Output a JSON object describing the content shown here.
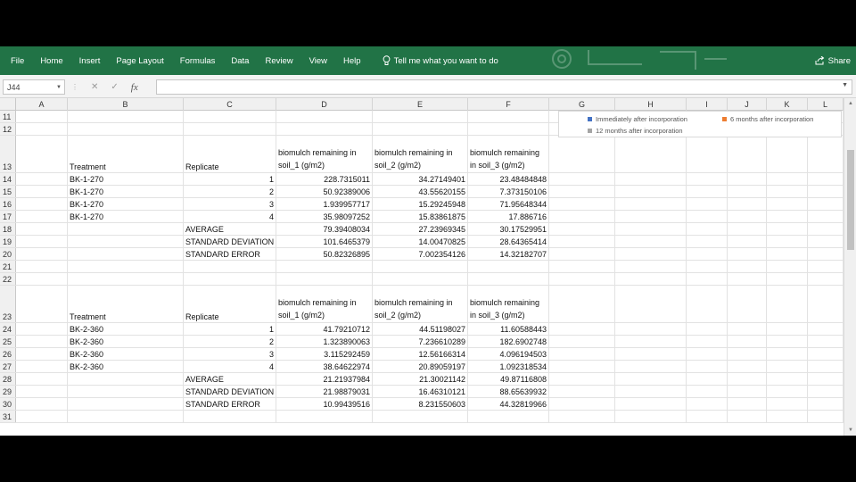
{
  "ribbon": {
    "tabs": [
      "File",
      "Home",
      "Insert",
      "Page Layout",
      "Formulas",
      "Data",
      "Review",
      "View",
      "Help"
    ],
    "tell_me": "Tell me what you want to do",
    "share": "Share",
    "accent": "#217346"
  },
  "formula_bar": {
    "name_box": "J44",
    "cancel_icon": "✕",
    "enter_icon": "✓",
    "fx_label": "fx",
    "content": ""
  },
  "columns": [
    "A",
    "B",
    "C",
    "D",
    "E",
    "F",
    "G",
    "H",
    "I",
    "J",
    "K",
    "L"
  ],
  "legend": {
    "items": [
      {
        "label": "Immediately after incorporation",
        "color": "#4472c4"
      },
      {
        "label": "6 months after incorporation",
        "color": "#ed7d31"
      },
      {
        "label": "12 months after incorporation",
        "color": "#a5a5a5"
      }
    ]
  },
  "rows": [
    {
      "n": "11",
      "cells": {}
    },
    {
      "n": "12",
      "cells": {}
    },
    {
      "n": "13",
      "cells": {
        "B": "Treatment",
        "C": "Replicate",
        "D": "biomulch remaining in soil_1 (g/m2)",
        "E": "biomulch remaining in soil_2 (g/m2)",
        "F": "biomulch remaining in soil_3 (g/m2)"
      }
    },
    {
      "n": "14",
      "cells": {
        "B": "BK-1-270",
        "C": "1",
        "D": "228.7315011",
        "E": "34.27149401",
        "F": "23.48484848"
      }
    },
    {
      "n": "15",
      "cells": {
        "B": "BK-1-270",
        "C": "2",
        "D": "50.92389006",
        "E": "43.55620155",
        "F": "7.373150106"
      }
    },
    {
      "n": "16",
      "cells": {
        "B": "BK-1-270",
        "C": "3",
        "D": "1.939957717",
        "E": "15.29245948",
        "F": "71.95648344"
      }
    },
    {
      "n": "17",
      "cells": {
        "B": "BK-1-270",
        "C": "4",
        "D": "35.98097252",
        "E": "15.83861875",
        "F": "17.886716"
      }
    },
    {
      "n": "18",
      "cells": {
        "C": "AVERAGE",
        "D": "79.39408034",
        "E": "27.23969345",
        "F": "30.17529951"
      }
    },
    {
      "n": "19",
      "cells": {
        "C": "STANDARD DEVIATION",
        "D": "101.6465379",
        "E": "14.00470825",
        "F": "28.64365414"
      }
    },
    {
      "n": "20",
      "cells": {
        "C": "STANDARD ERROR",
        "D": "50.82326895",
        "E": "7.002354126",
        "F": "14.32182707"
      }
    },
    {
      "n": "21",
      "cells": {}
    },
    {
      "n": "22",
      "cells": {}
    },
    {
      "n": "23",
      "cells": {
        "B": "Treatment",
        "C": "Replicate",
        "D": "biomulch remaining in soil_1 (g/m2)",
        "E": "biomulch remaining in soil_2 (g/m2)",
        "F": "biomulch remaining in soil_3 (g/m2)"
      }
    },
    {
      "n": "24",
      "cells": {
        "B": "BK-2-360",
        "C": "1",
        "D": "41.79210712",
        "E": "44.51198027",
        "F": "11.60588443"
      }
    },
    {
      "n": "25",
      "cells": {
        "B": "BK-2-360",
        "C": "2",
        "D": "1.323890063",
        "E": "7.236610289",
        "F": "182.6902748"
      }
    },
    {
      "n": "26",
      "cells": {
        "B": "BK-2-360",
        "C": "3",
        "D": "3.115292459",
        "E": "12.56166314",
        "F": "4.096194503"
      }
    },
    {
      "n": "27",
      "cells": {
        "B": "BK-2-360",
        "C": "4",
        "D": "38.64622974",
        "E": "20.89059197",
        "F": "1.092318534"
      }
    },
    {
      "n": "28",
      "cells": {
        "C": "AVERAGE",
        "D": "21.21937984",
        "E": "21.30021142",
        "F": "49.87116808"
      }
    },
    {
      "n": "29",
      "cells": {
        "C": "STANDARD DEVIATION",
        "D": "21.98879031",
        "E": "16.46310121",
        "F": "88.65639932"
      }
    },
    {
      "n": "30",
      "cells": {
        "C": "STANDARD ERROR",
        "D": "10.99439516",
        "E": "8.231550603",
        "F": "44.32819966"
      }
    },
    {
      "n": "31",
      "cells": {}
    }
  ]
}
